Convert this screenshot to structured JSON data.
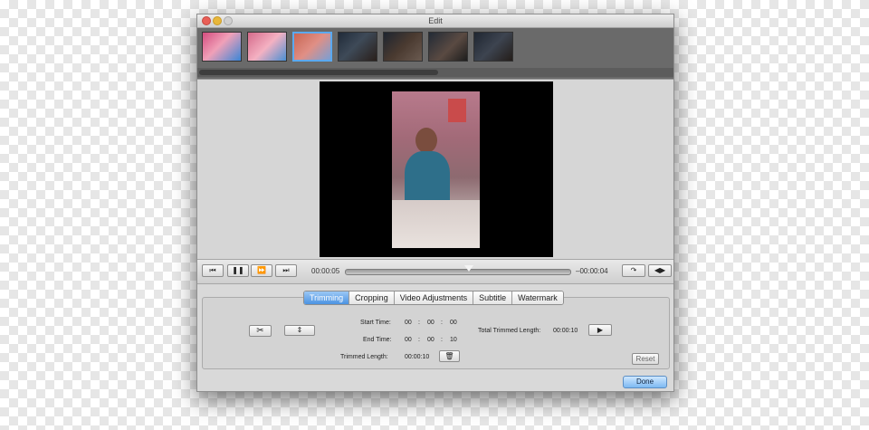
{
  "window": {
    "title": "Edit"
  },
  "playback": {
    "current_time": "00:00:05",
    "remaining_time": "–00:00:04",
    "progress": 0.55
  },
  "tabs": [
    {
      "label": "Trimming",
      "active": true
    },
    {
      "label": "Cropping",
      "active": false
    },
    {
      "label": "Video Adjustments",
      "active": false
    },
    {
      "label": "Subtitle",
      "active": false
    },
    {
      "label": "Watermark",
      "active": false
    }
  ],
  "trimming": {
    "start_label": "Start Time:",
    "start": {
      "h": "00",
      "m": "00",
      "s": "00"
    },
    "end_label": "End Time:",
    "end": {
      "h": "00",
      "m": "00",
      "s": "10"
    },
    "trimmed_label": "Trimmed Length:",
    "trimmed_value": "00:00:10",
    "total_label": "Total Trimmed Length:",
    "total_value": "00:00:10",
    "separator": ":"
  },
  "buttons": {
    "reset": "Reset",
    "done": "Done"
  },
  "icons": {
    "scissors": "scissors-icon",
    "trash": "trash-icon",
    "play_segment": "play-segment-icon"
  },
  "colors": {
    "accent": "#4b93e2",
    "window_bg": "#d9d9d9",
    "filmstrip_bg": "#6a6a6a"
  }
}
